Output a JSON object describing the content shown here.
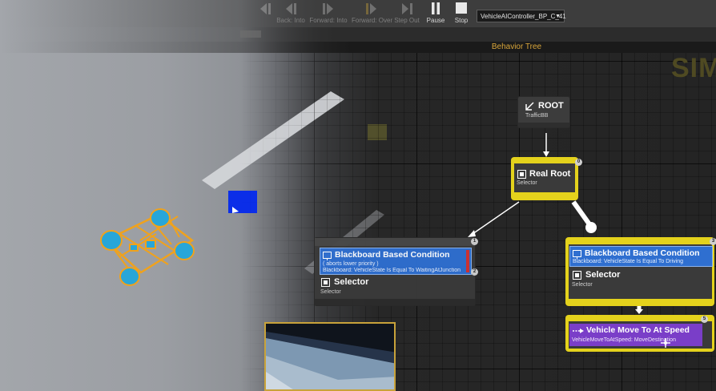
{
  "toolbar": {
    "buttons": [
      {
        "label": "",
        "icon": "back-icon",
        "enabled": false
      },
      {
        "label": "Back: Into",
        "icon": "back-into-icon",
        "enabled": false
      },
      {
        "label": "Forward: Into",
        "icon": "forward-into-icon",
        "enabled": false
      },
      {
        "label": "Forward: Over",
        "icon": "forward-over-icon",
        "enabled": false
      },
      {
        "label": "Step Out",
        "icon": "step-out-icon",
        "enabled": false
      },
      {
        "label": "Pause",
        "icon": "pause-icon",
        "enabled": true
      },
      {
        "label": "Stop",
        "icon": "stop-icon",
        "enabled": true
      }
    ],
    "debug_object": "VehicleAIController_BP_C_41"
  },
  "graph": {
    "title": "Behavior Tree",
    "watermark": "SIM"
  },
  "nodes": {
    "root": {
      "title": "ROOT",
      "subtitle": "TrafficBB"
    },
    "real_root": {
      "title": "Real Root",
      "subtitle": "Selector",
      "index": "0"
    },
    "left_branch": {
      "index": "1",
      "decorator_title": "Blackboard Based Condition",
      "decorator_line1": "( aborts lower priority )",
      "decorator_line2": "Blackboard: VehicleState Is Equal To WaitingAtJunction",
      "decorator_index": "2",
      "composite_title": "Selector",
      "composite_subtitle": "Selector"
    },
    "right_branch": {
      "index": "3",
      "decorator_title": "Blackboard Based Condition",
      "decorator_line1": "Blackboard: VehicleState Is Equal To Driving",
      "composite_title": "Selector",
      "composite_subtitle": "Selector"
    },
    "task": {
      "index": "5",
      "title": "Vehicle Move To At Speed",
      "subtitle": "VehicleMoveToAtSpeed: MoveDestination"
    }
  },
  "colors": {
    "active_outline": "#e4d21c",
    "decorator_blue": "#2f6fd0",
    "task_purple": "#7a3ec8",
    "graph_title": "#d8a53a",
    "selection_blue": "#0b2ee8"
  }
}
